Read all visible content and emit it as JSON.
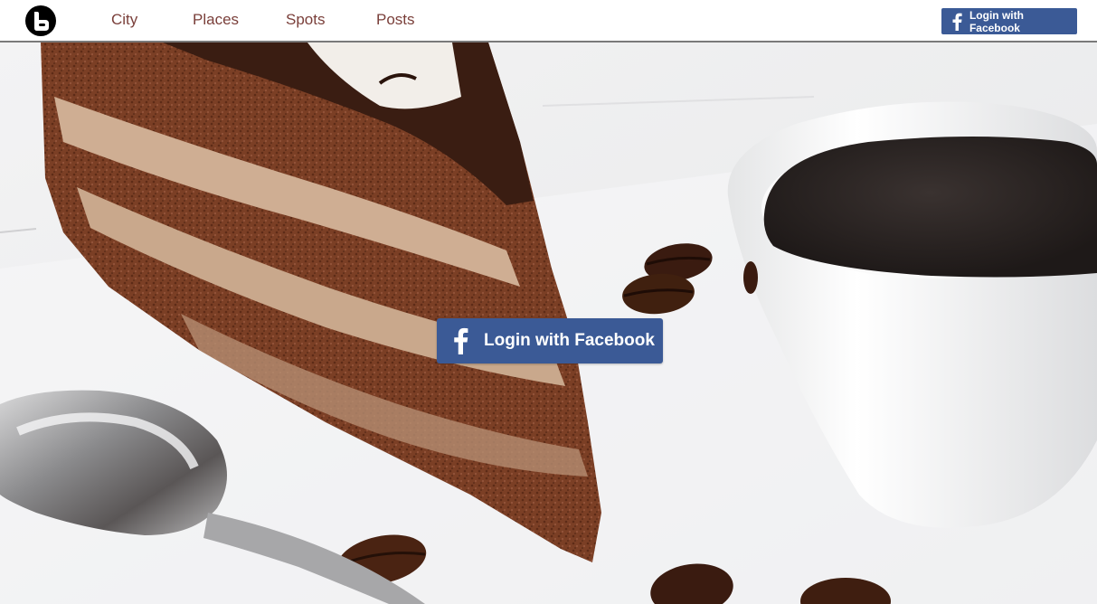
{
  "nav": {
    "logo_icon": "blogger-b-icon",
    "items": [
      {
        "label": "City"
      },
      {
        "label": "Places"
      },
      {
        "label": "Spots"
      },
      {
        "label": "Posts"
      }
    ],
    "login_label": "Login with Facebook",
    "login_icon": "facebook-f-icon"
  },
  "hero": {
    "image_subject": "chocolate cake slice with coffee cup, spoon and coffee beans",
    "login_label": "Login with Facebook",
    "login_icon": "facebook-f-icon"
  },
  "colors": {
    "facebook_blue": "#3b5a96",
    "nav_link": "#7a3f3a",
    "nav_border": "#7a7a7a"
  }
}
